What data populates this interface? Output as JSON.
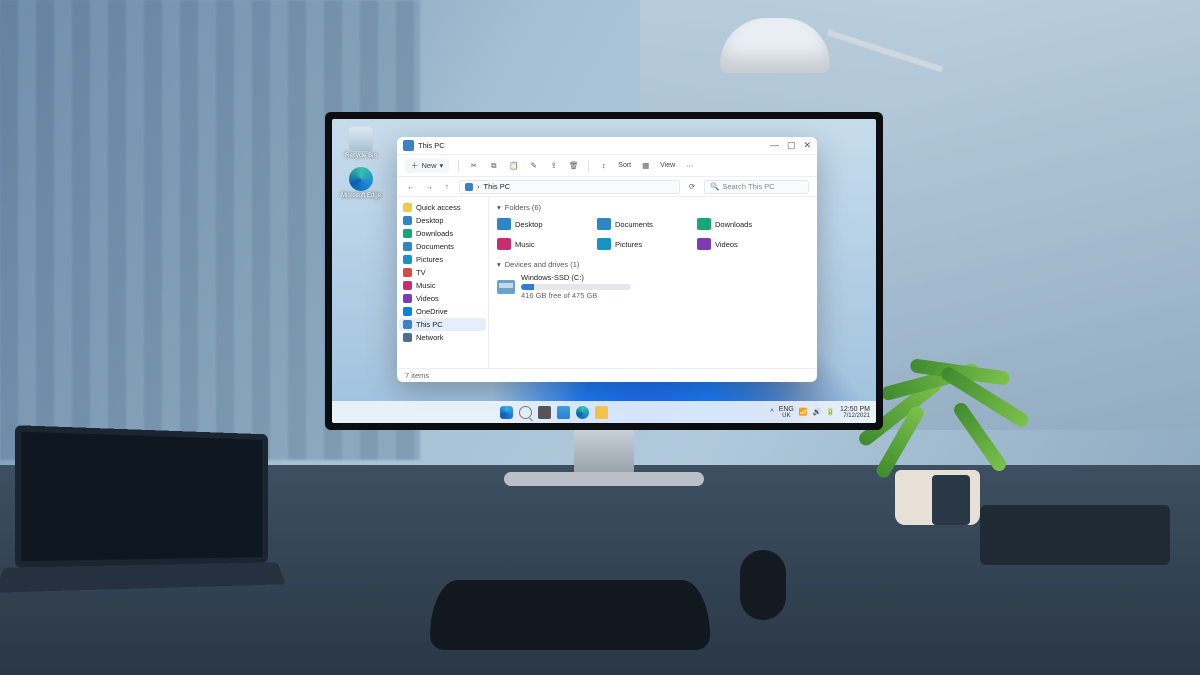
{
  "desktop_icons": [
    {
      "label": "Recycle Bin"
    },
    {
      "label": "Microsoft Edge"
    }
  ],
  "explorer": {
    "title": "This PC",
    "toolbar": {
      "new_label": "New",
      "sort_label": "Sort",
      "view_label": "View"
    },
    "addr": {
      "path_root": "This PC",
      "search_placeholder": "Search This PC"
    },
    "sidebar": {
      "quick_label": "Quick access",
      "quick": [
        "Desktop",
        "Downloads",
        "Documents",
        "Pictures"
      ],
      "tv_label": "TV",
      "tv": [
        "Music",
        "Videos"
      ],
      "onedrive": "OneDrive",
      "thispc": "This PC",
      "network": "Network"
    },
    "sections": {
      "folders_h": "Folders (6)",
      "drives_h": "Devices and drives (1)"
    },
    "folders": [
      "Desktop",
      "Documents",
      "Downloads",
      "Music",
      "Pictures",
      "Videos"
    ],
    "folder_colors": [
      "#2f86c7",
      "#2f86c7",
      "#17a678",
      "#c52f72",
      "#1695c4",
      "#7a3db5"
    ],
    "drive": {
      "name": "Windows-SSD (C:)",
      "free_text": "416 GB free of 475 GB",
      "used_pct": 12
    },
    "status": "7 items"
  },
  "taskbar": {
    "lang": "ENG",
    "region": "UK",
    "time": "12:50 PM",
    "date": "7/12/2021"
  }
}
